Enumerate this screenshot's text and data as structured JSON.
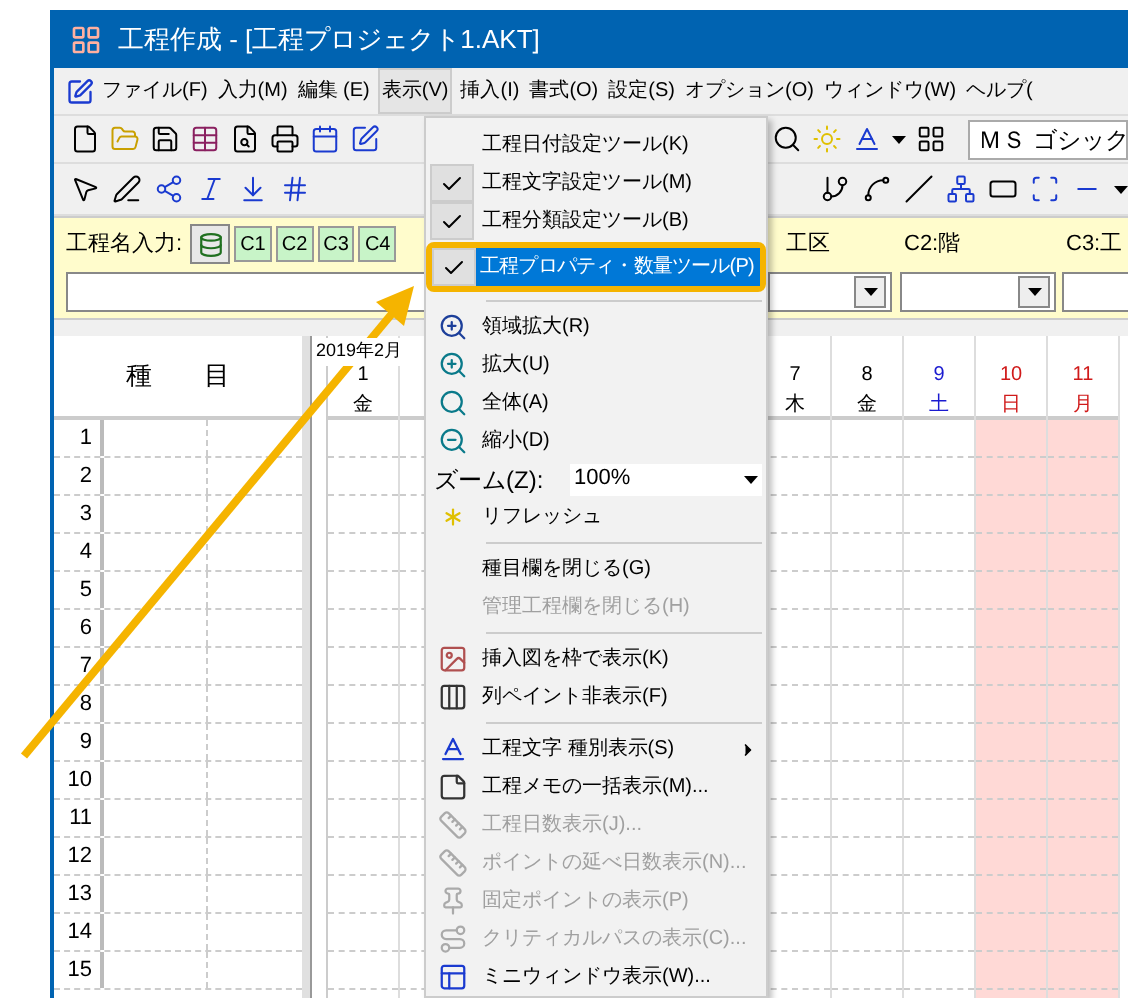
{
  "window": {
    "title": "工程作成 - [工程プロジェクト1.AKT]"
  },
  "menu_bar": [
    {
      "label": "ファイル(F)",
      "selected": false
    },
    {
      "label": "入力(M)",
      "selected": false
    },
    {
      "label": "編集 (E)",
      "selected": false
    },
    {
      "label": "表示(V)",
      "selected": true
    },
    {
      "label": "挿入(I)",
      "selected": false
    },
    {
      "label": "書式(O)",
      "selected": false
    },
    {
      "label": "設定(S)",
      "selected": false
    },
    {
      "label": "オプション(O)",
      "selected": false
    },
    {
      "label": "ウィンドウ(W)",
      "selected": false
    },
    {
      "label": "ヘルプ(",
      "selected": false
    }
  ],
  "font_field": {
    "value": "ＭＳ ゴシック"
  },
  "process_input": {
    "label": "工程名入力:",
    "category_buttons": [
      "C1",
      "C2",
      "C3",
      "C4"
    ],
    "fields": [
      {
        "label": "工区"
      },
      {
        "label": "C2:階"
      },
      {
        "label": "C3:工"
      }
    ]
  },
  "grid": {
    "type_header": "種　　目",
    "month": "2019年2月",
    "days": [
      {
        "day": "1",
        "weekday": "金",
        "kind": "weekday"
      },
      {
        "day": "7",
        "weekday": "木",
        "kind": "weekday"
      },
      {
        "day": "8",
        "weekday": "金",
        "kind": "weekday"
      },
      {
        "day": "9",
        "weekday": "土",
        "kind": "saturday"
      },
      {
        "day": "10",
        "weekday": "日",
        "kind": "holiday"
      },
      {
        "day": "11",
        "weekday": "月",
        "kind": "holiday"
      }
    ],
    "rows": [
      "1",
      "2",
      "3",
      "4",
      "5",
      "6",
      "7",
      "8",
      "9",
      "10",
      "11",
      "12",
      "13",
      "14",
      "15"
    ]
  },
  "dropdown_menu": [
    {
      "kind": "item",
      "label": "工程日付設定ツール(K)",
      "checked": false,
      "selected": false,
      "disabled": false
    },
    {
      "kind": "item",
      "label": "工程文字設定ツール(M)",
      "checked": true,
      "selected": false,
      "disabled": false
    },
    {
      "kind": "item",
      "label": "工程分類設定ツール(B)",
      "checked": true,
      "selected": false,
      "disabled": false
    },
    {
      "kind": "item",
      "label": "工程プロパティ・数量ツール(P)",
      "checked": true,
      "selected": true,
      "disabled": false
    },
    {
      "kind": "separator"
    },
    {
      "kind": "item",
      "label": "領域拡大(R)",
      "checked": false,
      "selected": false,
      "disabled": false
    },
    {
      "kind": "item",
      "label": "拡大(U)",
      "checked": false,
      "selected": false,
      "disabled": false
    },
    {
      "kind": "item",
      "label": "全体(A)",
      "checked": false,
      "selected": false,
      "disabled": false
    },
    {
      "kind": "item",
      "label": "縮小(D)",
      "checked": false,
      "selected": false,
      "disabled": false
    },
    {
      "kind": "zoom",
      "label": "ズーム(Z):",
      "value": "100%"
    },
    {
      "kind": "item",
      "label": "リフレッシュ",
      "checked": false,
      "selected": false,
      "disabled": false
    },
    {
      "kind": "separator"
    },
    {
      "kind": "item",
      "label": "種目欄を閉じる(G)",
      "checked": false,
      "selected": false,
      "disabled": false
    },
    {
      "kind": "item",
      "label": "管理工程欄を閉じる(H)",
      "checked": false,
      "selected": false,
      "disabled": true
    },
    {
      "kind": "separator"
    },
    {
      "kind": "item",
      "label": "挿入図を枠で表示(K)",
      "checked": false,
      "selected": false,
      "disabled": false
    },
    {
      "kind": "item",
      "label": "列ペイント非表示(F)",
      "checked": false,
      "selected": false,
      "disabled": false
    },
    {
      "kind": "separator"
    },
    {
      "kind": "item",
      "label": "工程文字 種別表示(S)",
      "checked": false,
      "selected": false,
      "disabled": false,
      "submenu": true
    },
    {
      "kind": "item",
      "label": "工程メモの一括表示(M)...",
      "checked": false,
      "selected": false,
      "disabled": false
    },
    {
      "kind": "item",
      "label": "工程日数表示(J)...",
      "checked": false,
      "selected": false,
      "disabled": true
    },
    {
      "kind": "item",
      "label": "ポイントの延べ日数表示(N)...",
      "checked": false,
      "selected": false,
      "disabled": true
    },
    {
      "kind": "item",
      "label": "固定ポイントの表示(P)",
      "checked": false,
      "selected": false,
      "disabled": true
    },
    {
      "kind": "item",
      "label": "クリティカルパスの表示(C)...",
      "checked": false,
      "selected": false,
      "disabled": true
    },
    {
      "kind": "item",
      "label": "ミニウィンドウ表示(W)...",
      "checked": false,
      "selected": false,
      "disabled": false
    }
  ]
}
